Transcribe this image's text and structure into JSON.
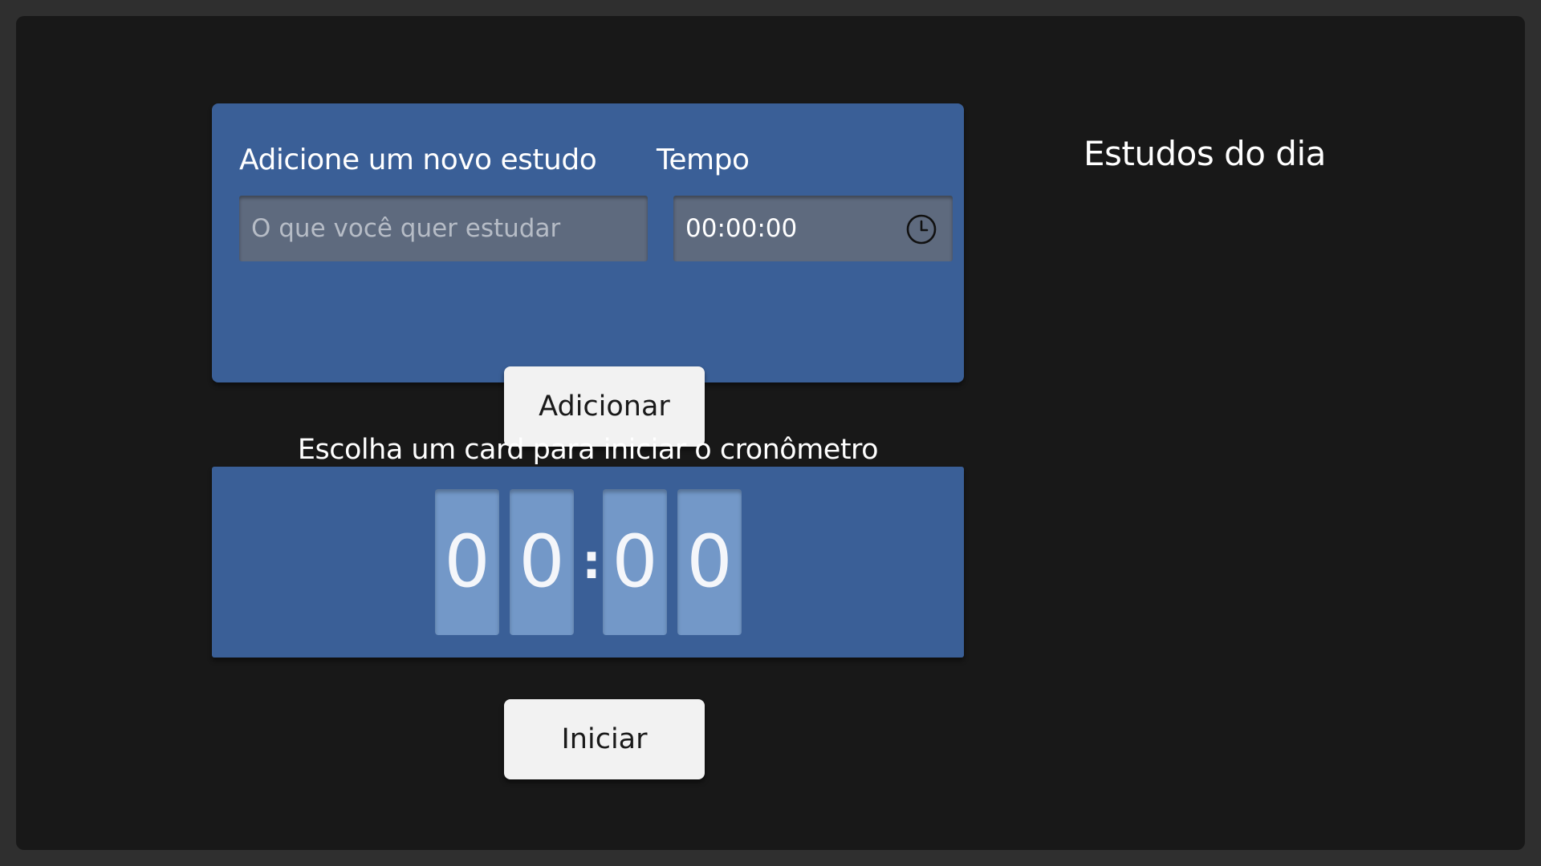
{
  "form": {
    "study_label": "Adicione um novo estudo",
    "time_label": "Tempo",
    "study_placeholder": "O que você quer estudar",
    "time_value": "00:00:00",
    "add_button": "Adicionar"
  },
  "timer": {
    "title": "Escolha um card para iniciar o cronômetro",
    "digits": [
      "0",
      "0",
      "0",
      "0"
    ],
    "separator": ":",
    "start_button": "Iniciar"
  },
  "sidebar": {
    "title": "Estudos do dia"
  },
  "colors": {
    "background": "#181818",
    "card": "#3a5f97",
    "digit": "#7398c8"
  }
}
